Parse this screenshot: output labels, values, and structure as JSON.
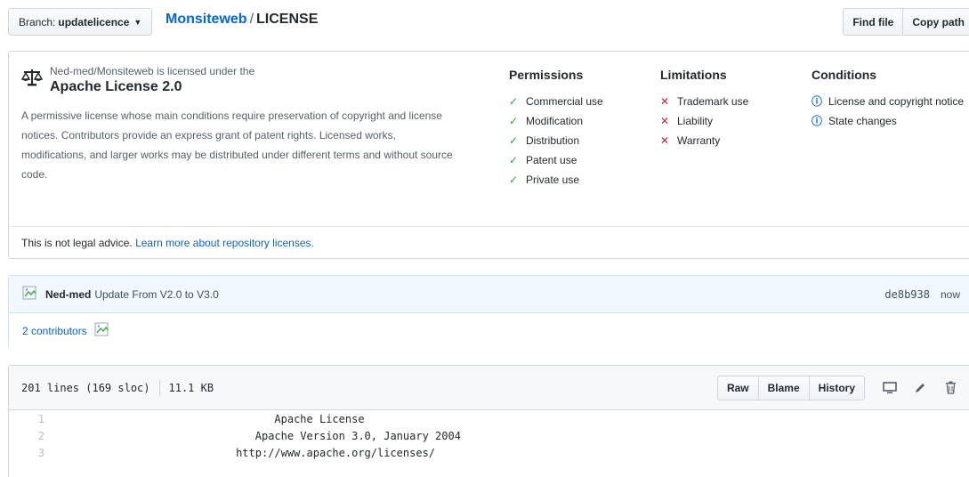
{
  "topbar": {
    "branch_prefix": "Branch:",
    "branch_name": "updatelicence",
    "repo": "Monsiteweb",
    "separator": "/",
    "file": "LICENSE",
    "find_file": "Find file",
    "copy_path": "Copy path"
  },
  "license": {
    "licensed_by": "Ned-med/Monsiteweb is licensed under the",
    "name": "Apache License 2.0",
    "description": "A permissive license whose main conditions require preservation of copyright and license notices. Contributors provide an express grant of patent rights. Licensed works, modifications, and larger works may be distributed under different terms and without source code.",
    "permissions": {
      "title": "Permissions",
      "items": [
        "Commercial use",
        "Modification",
        "Distribution",
        "Patent use",
        "Private use"
      ]
    },
    "limitations": {
      "title": "Limitations",
      "items": [
        "Trademark use",
        "Liability",
        "Warranty"
      ]
    },
    "conditions": {
      "title": "Conditions",
      "items": [
        "License and copyright notice",
        "State changes"
      ]
    },
    "legal_text": "This is not legal advice.",
    "legal_link": "Learn more about repository licenses."
  },
  "commit": {
    "author": "Ned-med",
    "message": "Update From V2.0 to V3.0",
    "sha": "de8b938",
    "time": "now",
    "contributors": "2 contributors"
  },
  "file": {
    "lines_info": "201 lines (169 sloc)",
    "size": "11.1 KB",
    "raw": "Raw",
    "blame": "Blame",
    "history": "History",
    "icons": [
      "desktop-icon",
      "pencil-icon",
      "trash-icon"
    ],
    "code_lines": [
      {
        "num": "1",
        "text": "                                 Apache License"
      },
      {
        "num": "2",
        "text": "                              Apache Version 3.0, January 2004"
      },
      {
        "num": "3",
        "text": "                           http://www.apache.org/licenses/"
      }
    ]
  },
  "colors": {
    "link": "#0366d6",
    "check": "#28a745",
    "cross": "#cb2431",
    "commit_bg": "#f1f8ff"
  }
}
